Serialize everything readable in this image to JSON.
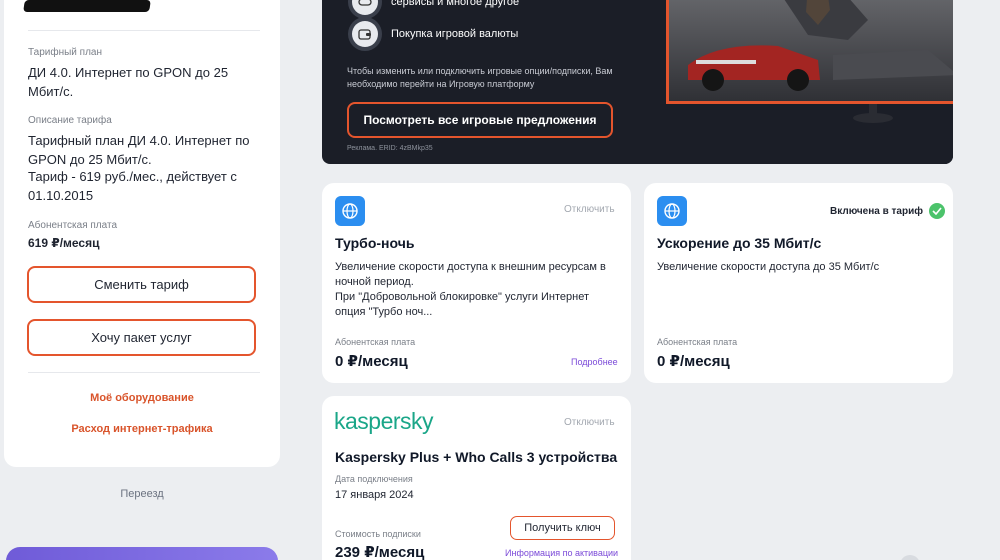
{
  "tariff": {
    "plan_label": "Тарифный план",
    "plan_value": "ДИ 4.0. Интернет по GPON до 25 Мбит/с.",
    "description_label": "Описание тарифа",
    "description_line1": "Тарифный план ДИ 4.0. Интернет по GPON до 25 Мбит/с.",
    "description_line2": "Тариф - 619 руб./мес., действует с 01.10.2015",
    "fee_label": "Абонентская плата",
    "fee_value": "619 ₽/месяц",
    "change_button": "Сменить тариф",
    "bundle_button": "Хочу пакет услуг",
    "equipment_link": "Моё оборудование",
    "traffic_link": "Расход интернет-трафика",
    "move_link": "Переезд"
  },
  "game_banner": {
    "partial_line": "сервисы и многое другое",
    "currency_item": "Покупка игровой валюты",
    "note": "Чтобы изменить или подключить игровые опции/подписки, Вам необходимо перейти на Игровую платформу",
    "button": "Посмотреть все игровые предложения",
    "ad_label": "Реклама. ERID: 4zBMkp35",
    "icons": [
      "controller-icon",
      "wallet-icon"
    ]
  },
  "options": [
    {
      "title": "Турбо-ночь",
      "status": "Отключить",
      "description_line1": "Увеличение скорости доступа к внешним ресурсам в ночной период.",
      "description_line2": "При \"Добровольной блокировке\" услуги Интернет опция \"Турбо ноч...",
      "fee_label": "Абонентская плата",
      "fee": "0 ₽/месяц",
      "more": "Подробнее",
      "icon": "globe-icon"
    },
    {
      "title": "Ускорение до 35 Мбит/с",
      "status": "Включена в тариф",
      "description_line1": "Увеличение скорости доступа до 35 Мбит/с",
      "fee_label": "Абонентская плата",
      "fee": "0 ₽/месяц",
      "icon": "globe-icon"
    }
  ],
  "kaspersky": {
    "logo": "kaspersky",
    "status": "Отключить",
    "title": "Kaspersky Plus + Who Calls 3 устройства",
    "date_label": "Дата подключения",
    "date": "17 января 2024",
    "cost_label": "Стоимость подписки",
    "cost": "239 ₽/месяц",
    "key_button": "Получить ключ",
    "activation_link": "Информация по активации"
  },
  "colors": {
    "accent": "#e4552d",
    "link_purple": "#7b4ad8",
    "kaspersky_green": "#1aa688",
    "icon_blue": "#2b8ef0",
    "banner_dark": "#1b1e27"
  }
}
